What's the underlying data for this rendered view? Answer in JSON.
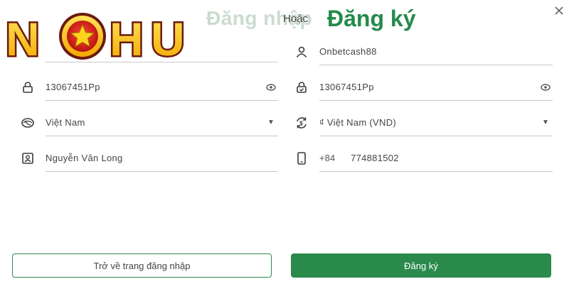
{
  "brand": {
    "logo_text": "NOHU",
    "colors": {
      "primary_green": "#2a8a4c",
      "logo_yellow": "#f7c81e",
      "logo_red": "#d7261d"
    }
  },
  "header": {
    "login_tab": "Đăng nhập",
    "or_text": "Hoặc",
    "register_tab": "Đăng ký",
    "close_icon": "close-icon"
  },
  "form": {
    "left": {
      "username": {
        "value": "",
        "icon": "user-icon"
      },
      "password": {
        "value": "13067451Pp",
        "icon": "lock-icon",
        "trail_icon": "eye-icon"
      },
      "country": {
        "value": "Việt Nam",
        "icon": "globe-icon",
        "trail_icon": "caret-down-icon"
      },
      "full_name": {
        "value": "Nguyễn Văn Long",
        "icon": "id-card-icon"
      }
    },
    "right": {
      "username": {
        "value": "Onbetcash88",
        "icon": "user-icon"
      },
      "confirm_password": {
        "value": "13067451Pp",
        "icon": "lock-check-icon",
        "trail_icon": "eye-icon"
      },
      "currency": {
        "value": "₫ Việt Nam (VND)",
        "icon": "currency-exchange-icon",
        "trail_icon": "caret-down-icon"
      },
      "phone": {
        "prefix": "+84",
        "value": "774881502",
        "icon": "phone-icon"
      }
    }
  },
  "buttons": {
    "back_to_login": "Trở về trang đăng nhập",
    "register": "Đăng ký"
  }
}
